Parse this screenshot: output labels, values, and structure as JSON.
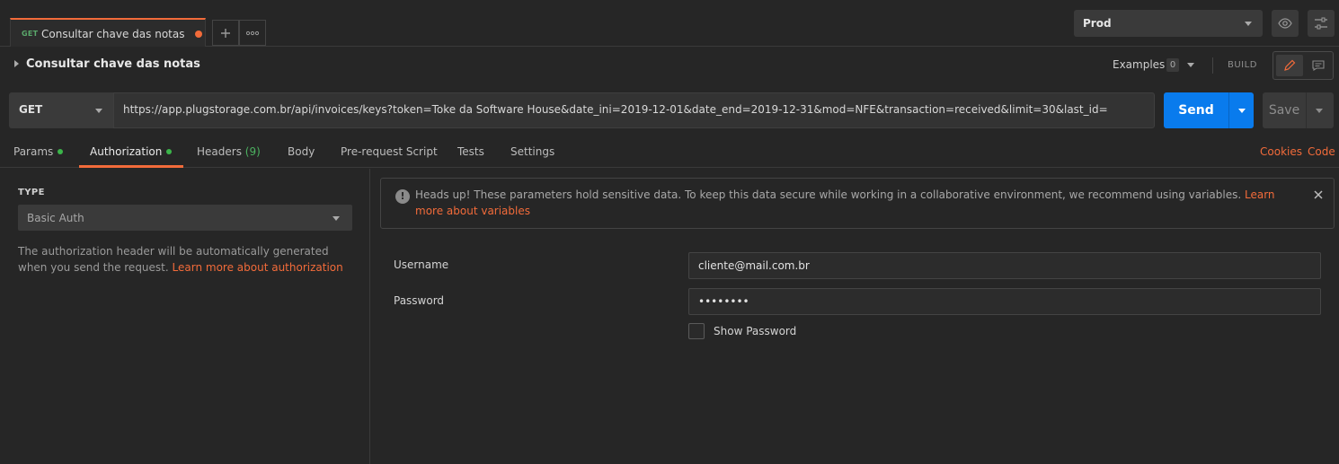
{
  "tabs": {
    "request_tab": {
      "method": "GET",
      "name": "Consultar chave das notas"
    },
    "add_tab_icon": "plus-icon",
    "more_tabs_icon": "more-horizontal-icon"
  },
  "environment": {
    "selected": "Prod",
    "quick_look_icon": "eye-icon",
    "manage_icon": "sliders-icon"
  },
  "request": {
    "title": "Consultar chave das notas",
    "examples_label": "Examples",
    "examples_count": "0",
    "build_label": "BUILD"
  },
  "url_bar": {
    "method": "GET",
    "url": "https://app.plugstorage.com.br/api/invoices/keys?token=Toke da Software House&date_ini=2019-12-01&date_end=2019-12-31&mod=NFE&transaction=received&limit=30&last_id=",
    "send_label": "Send",
    "save_label": "Save"
  },
  "subtabs": {
    "params": "Params",
    "authorization": "Authorization",
    "headers": "Headers",
    "headers_count": "(9)",
    "body": "Body",
    "prerequest": "Pre-request Script",
    "tests": "Tests",
    "settings": "Settings",
    "cookies": "Cookies",
    "code": "Code"
  },
  "auth": {
    "type_label": "TYPE",
    "type_value": "Basic Auth",
    "description": "The authorization header will be automatically generated when you send the request.",
    "description_link": "Learn more about authorization"
  },
  "alert": {
    "message": "Heads up! These parameters hold sensitive data. To keep this data secure while working in a collaborative environment, we recommend using variables.",
    "link": "Learn more about variables"
  },
  "form": {
    "username_label": "Username",
    "username_value": "cliente@mail.com.br",
    "password_label": "Password",
    "password_value": "••••••••",
    "show_password_label": "Show Password"
  },
  "colors": {
    "accent": "#f26b3a",
    "send_blue": "#097bed",
    "success_green": "#3bb54a"
  }
}
